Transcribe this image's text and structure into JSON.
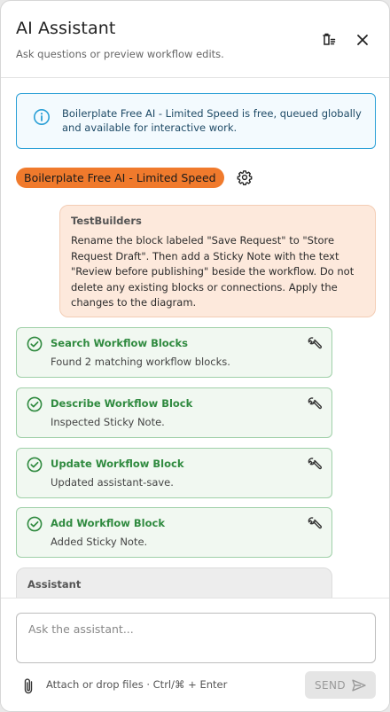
{
  "header": {
    "title": "AI Assistant",
    "subtitle": "Ask questions or preview workflow edits."
  },
  "info_banner": {
    "text": "Boilerplate Free AI - Limited Speed is free, queued globally and available for interactive work."
  },
  "model": {
    "name": "Boilerplate Free AI - Limited Speed"
  },
  "user_message": {
    "author": "TestBuilders",
    "text": "Rename the block labeled \"Save Request\" to \"Store Request Draft\". Then add a Sticky Note with the text \"Review before publishing\" beside the workflow. Do not delete any existing blocks or connections. Apply the changes to the diagram."
  },
  "tool_calls": [
    {
      "name": "Search Workflow Blocks",
      "result": "Found 2 matching workflow blocks."
    },
    {
      "name": "Describe Workflow Block",
      "result": "Inspected Sticky Note."
    },
    {
      "name": "Update Workflow Block",
      "result": "Updated assistant-save."
    },
    {
      "name": "Add Workflow Block",
      "result": "Added Sticky Note."
    }
  ],
  "assistant_message": {
    "author": "Assistant"
  },
  "composer": {
    "placeholder": "Ask the assistant...",
    "attach_hint": "Attach or drop files · Ctrl/⌘ + Enter",
    "send_label": "SEND"
  },
  "colors": {
    "accent_orange": "#f07a2c",
    "info_blue": "#2a9fd6",
    "success_green": "#2f8a3f",
    "user_bubble": "#fde9dc"
  }
}
